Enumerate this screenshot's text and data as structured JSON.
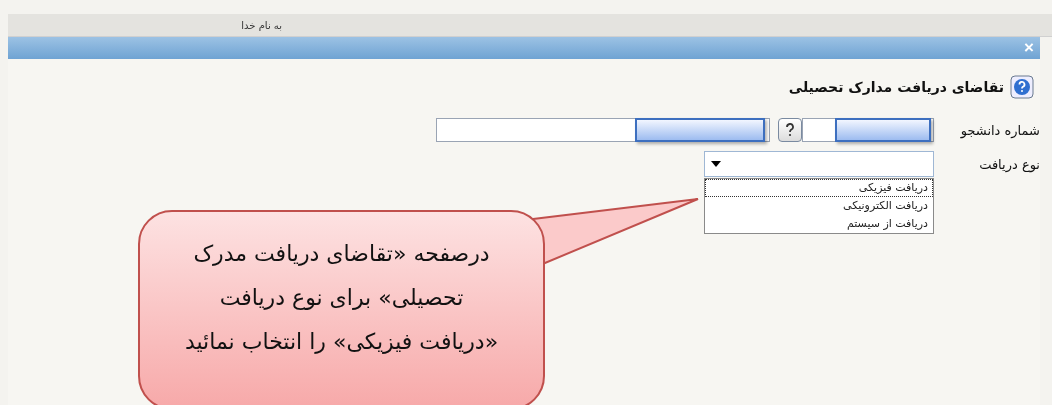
{
  "header": {
    "caption": "به نام خدا"
  },
  "dialog": {
    "close": "×",
    "title": "تقاضای دریافت مدارک تحصیلی",
    "student": {
      "label": "شماره دانشجو"
    },
    "receive_type": {
      "label": "نوع دریافت",
      "expanded": true,
      "options": [
        {
          "label": "دریافت فیزیکی",
          "selected": true
        },
        {
          "label": "دریافت الکترونیکی",
          "selected": false
        },
        {
          "label": "دریافت از سیستم",
          "selected": false
        }
      ]
    }
  },
  "callout": {
    "lines": [
      "درصفحه «تقاضای دریافت مدرک",
      "تحصیلی» برای  نوع دریافت",
      "«دریافت فیزیکی» را انتخاب نمائید"
    ]
  }
}
